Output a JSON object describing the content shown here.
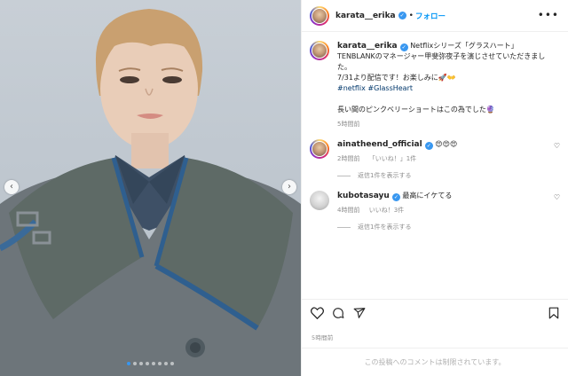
{
  "post": {
    "username": "karata__erika",
    "follow_label": "フォロー",
    "separator": "•",
    "media_dots": 8,
    "media_active_dot": 0
  },
  "caption": {
    "username": "karata__erika",
    "line1": "Netflixシリーズ「グラスハート」",
    "line2": "TENBLANKのマネージャー甲斐弥夜子を演じさせていただきまし",
    "line3": "た。",
    "line4": "7/31より配信です！お楽しみに🚀👐",
    "hashtag1": "#netflix",
    "hashtag2": "#GlassHeart",
    "line5": "長い間のピンクベリーショートはこの為でした🔮",
    "time": "5時間前"
  },
  "comments": [
    {
      "username": "ainatheend_official",
      "text": "😍😍😍",
      "time": "2時間前",
      "likes": "「いいね！」1件",
      "replies": "返信1件を表示する"
    },
    {
      "username": "kubotasayu",
      "text": "最高にイケてる",
      "time": "4時間前",
      "likes": "いいね！3件",
      "replies": "返信1件を表示する"
    }
  ],
  "footer": {
    "timestamp": "5時間前",
    "comments_disabled": "この投稿へのコメントは制限されています。"
  },
  "icons": {
    "heart": "heart-icon",
    "comment": "comment-icon",
    "share": "share-icon",
    "save": "bookmark-icon",
    "more": "more-options-icon"
  },
  "colors": {
    "link": "#0095f6",
    "verified": "#3897f0",
    "hashtag": "#00376b",
    "muted": "#8e8e8e"
  }
}
